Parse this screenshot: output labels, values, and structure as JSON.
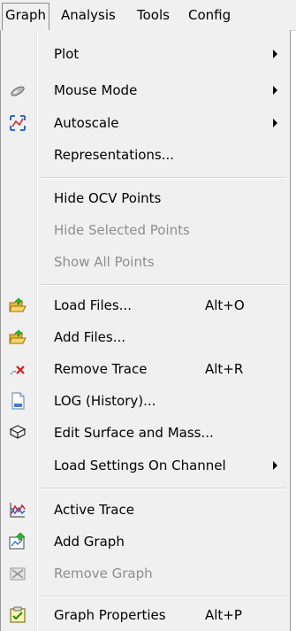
{
  "menubar": {
    "items": [
      "Graph",
      "Analysis",
      "Tools",
      "Config"
    ]
  },
  "menu": {
    "items": [
      {
        "label": "Plot",
        "submenu": true,
        "icon": "none"
      },
      {
        "label": "Mouse Mode",
        "submenu": true,
        "icon": "mouse-icon"
      },
      {
        "label": "Autoscale",
        "submenu": true,
        "icon": "autoscale-icon"
      },
      {
        "label": "Representations...",
        "icon": "none"
      },
      {
        "label": "Hide OCV Points",
        "icon": "none"
      },
      {
        "label": "Hide Selected Points",
        "disabled": true,
        "icon": "none"
      },
      {
        "label": "Show All Points",
        "disabled": true,
        "icon": "none"
      },
      {
        "label": "Load Files...",
        "shortcut": "Alt+O",
        "icon": "folder-open-icon"
      },
      {
        "label": "Add Files...",
        "icon": "folder-add-icon"
      },
      {
        "label": "Remove Trace",
        "shortcut": "Alt+R",
        "icon": "remove-trace-icon"
      },
      {
        "label": "LOG (History)...",
        "icon": "log-file-icon"
      },
      {
        "label": "Edit Surface and Mass...",
        "icon": "edit-surface-icon"
      },
      {
        "label": "Load Settings On Channel",
        "submenu": true,
        "icon": "none"
      },
      {
        "label": "Active Trace",
        "icon": "active-trace-icon"
      },
      {
        "label": "Add Graph",
        "icon": "add-graph-icon"
      },
      {
        "label": "Remove Graph",
        "disabled": true,
        "icon": "remove-graph-icon"
      },
      {
        "label": "Graph Properties",
        "shortcut": "Alt+P",
        "icon": "graph-properties-icon"
      }
    ]
  },
  "colors": {
    "menu_bg": "#f0f0f0",
    "disabled_text": "#8d8d8d",
    "separator": "#d6d6d6"
  }
}
